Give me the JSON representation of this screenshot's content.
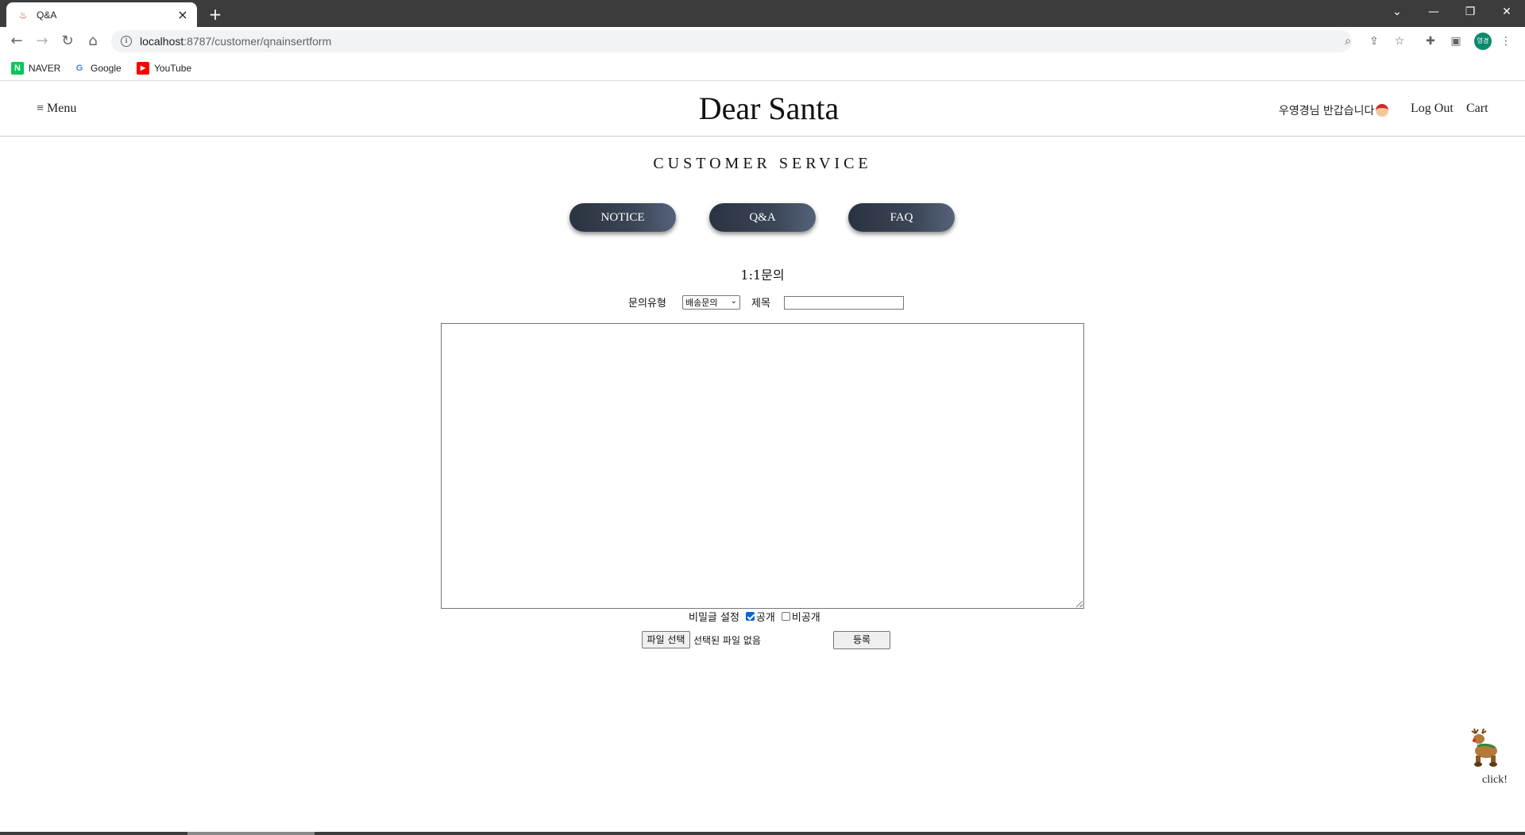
{
  "browser": {
    "tab_title": "Q&A",
    "tab_close": "×",
    "new_tab": "+",
    "url_host": "localhost",
    "url_path": ":8787/customer/qnainsertform",
    "profile_initials": "영경",
    "bookmarks": [
      {
        "label": "NAVER",
        "icon_text": "N",
        "color": "#03c75a"
      },
      {
        "label": "Google",
        "icon_text": "G",
        "color": "#4285f4"
      },
      {
        "label": "YouTube",
        "icon_text": "▶",
        "color": "#ff0000"
      }
    ]
  },
  "header": {
    "menu_label": "≡ Menu",
    "brand": "Dear Santa",
    "greeting": "우영경님 반갑습니다",
    "logout_label": "Log Out",
    "cart_label": "Cart"
  },
  "section_title": "CUSTOMER SERVICE",
  "nav_pills": {
    "notice": "NOTICE",
    "qna": "Q&A",
    "faq": "FAQ"
  },
  "form": {
    "title": "1:1문의",
    "type_label": "문의유형",
    "type_selected": "배송문의",
    "subject_label": "제목",
    "subject_value": "",
    "content_value": "",
    "secret_label": "비밀글 설정",
    "public_label": "공개",
    "public_checked": true,
    "private_label": "비공개",
    "private_checked": false,
    "file_button": "파일 선택",
    "file_status": "선택된 파일 없음",
    "submit_label": "등록"
  },
  "floating": {
    "click_label": "click!"
  },
  "colors": {
    "pill_dark": "#2a3340",
    "pill_light": "#55627a",
    "chrome_dark": "#3c3c3c"
  }
}
